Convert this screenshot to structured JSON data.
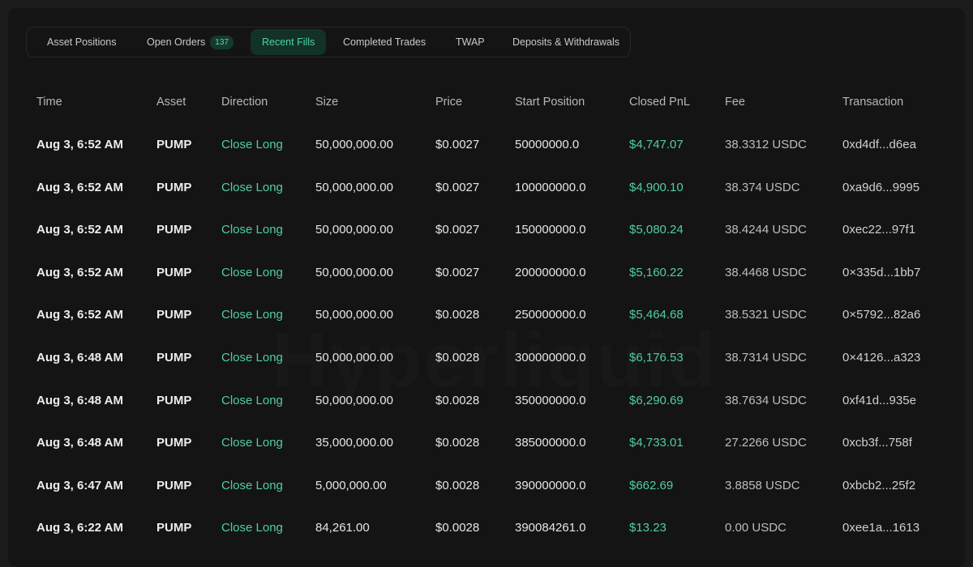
{
  "tabs": [
    {
      "label": "Asset Positions",
      "left": 0
    },
    {
      "label": "Open Orders",
      "badge": "137"
    },
    {
      "label": "Recent Fills",
      "active": true
    },
    {
      "label": "Completed Trades"
    },
    {
      "label": "TWAP"
    },
    {
      "label": "Deposits & Withdrawals"
    }
  ],
  "watermark": "Hyperliquid",
  "columns": {
    "time": "Time",
    "asset": "Asset",
    "direction": "Direction",
    "size": "Size",
    "price": "Price",
    "start_position": "Start Position",
    "closed_pnl": "Closed PnL",
    "fee": "Fee",
    "transaction": "Transaction"
  },
  "rows": [
    {
      "time": "Aug 3, 6:52 AM",
      "asset": "PUMP",
      "direction": "Close Long",
      "size": "50,000,000.00",
      "price": "$0.0027",
      "start": "50000000.0",
      "pnl": "$4,747.07",
      "fee": "38.3312 USDC",
      "tx": "0xd4df...d6ea"
    },
    {
      "time": "Aug 3, 6:52 AM",
      "asset": "PUMP",
      "direction": "Close Long",
      "size": "50,000,000.00",
      "price": "$0.0027",
      "start": "100000000.0",
      "pnl": "$4,900.10",
      "fee": "38.374 USDC",
      "tx": "0xa9d6...9995"
    },
    {
      "time": "Aug 3, 6:52 AM",
      "asset": "PUMP",
      "direction": "Close Long",
      "size": "50,000,000.00",
      "price": "$0.0027",
      "start": "150000000.0",
      "pnl": "$5,080.24",
      "fee": "38.4244 USDC",
      "tx": "0xec22...97f1"
    },
    {
      "time": "Aug 3, 6:52 AM",
      "asset": "PUMP",
      "direction": "Close Long",
      "size": "50,000,000.00",
      "price": "$0.0027",
      "start": "200000000.0",
      "pnl": "$5,160.22",
      "fee": "38.4468 USDC",
      "tx": "0×335d...1bb7"
    },
    {
      "time": "Aug 3, 6:52 AM",
      "asset": "PUMP",
      "direction": "Close Long",
      "size": "50,000,000.00",
      "price": "$0.0028",
      "start": "250000000.0",
      "pnl": "$5,464.68",
      "fee": "38.5321 USDC",
      "tx": "0×5792...82a6"
    },
    {
      "time": "Aug 3, 6:48 AM",
      "asset": "PUMP",
      "direction": "Close Long",
      "size": "50,000,000.00",
      "price": "$0.0028",
      "start": "300000000.0",
      "pnl": "$6,176.53",
      "fee": "38.7314 USDC",
      "tx": "0×4126...a323"
    },
    {
      "time": "Aug 3, 6:48 AM",
      "asset": "PUMP",
      "direction": "Close Long",
      "size": "50,000,000.00",
      "price": "$0.0028",
      "start": "350000000.0",
      "pnl": "$6,290.69",
      "fee": "38.7634 USDC",
      "tx": "0xf41d...935e"
    },
    {
      "time": "Aug 3, 6:48 AM",
      "asset": "PUMP",
      "direction": "Close Long",
      "size": "35,000,000.00",
      "price": "$0.0028",
      "start": "385000000.0",
      "pnl": "$4,733.01",
      "fee": "27.2266 USDC",
      "tx": "0xcb3f...758f"
    },
    {
      "time": "Aug 3, 6:47 AM",
      "asset": "PUMP",
      "direction": "Close Long",
      "size": "5,000,000.00",
      "price": "$0.0028",
      "start": "390000000.0",
      "pnl": "$662.69",
      "fee": "3.8858 USDC",
      "tx": "0xbcb2...25f2"
    },
    {
      "time": "Aug 3, 6:22 AM",
      "asset": "PUMP",
      "direction": "Close Long",
      "size": "84,261.00",
      "price": "$0.0028",
      "start": "390084261.0",
      "pnl": "$13.23",
      "fee": "0.00 USDC",
      "tx": "0xee1a...1613"
    }
  ]
}
